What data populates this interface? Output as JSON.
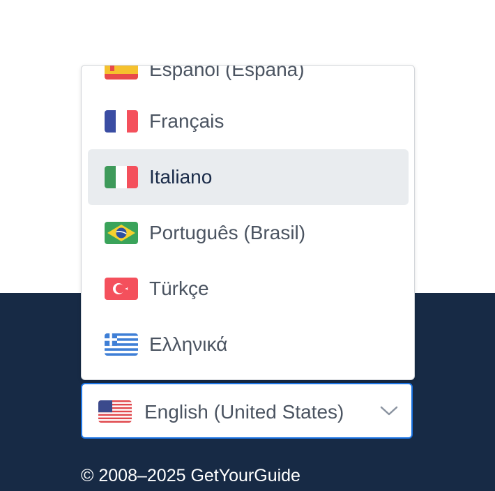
{
  "language_menu": {
    "options": [
      {
        "label": "Español (España)",
        "flag_icon": "spain-flag-icon"
      },
      {
        "label": "Français",
        "flag_icon": "france-flag-icon"
      },
      {
        "label": "Italiano",
        "flag_icon": "italy-flag-icon",
        "selected_highlight": true
      },
      {
        "label": "Português (Brasil)",
        "flag_icon": "brazil-flag-icon"
      },
      {
        "label": "Türkçe",
        "flag_icon": "turkey-flag-icon"
      },
      {
        "label": "Ελληνικά",
        "flag_icon": "greece-flag-icon"
      }
    ]
  },
  "language_select": {
    "value": "English (United States)",
    "flag_icon": "us-flag-icon",
    "chevron_icon": "chevron-down-icon"
  },
  "footer": {
    "copyright": "© 2008–2025 GetYourGuide"
  },
  "colors": {
    "footer_bg": "#172a45",
    "highlight_bg": "#e9ecef",
    "focus_border": "#1b74e4",
    "text": "#4b5461",
    "text_selected": "#1a2b49"
  }
}
